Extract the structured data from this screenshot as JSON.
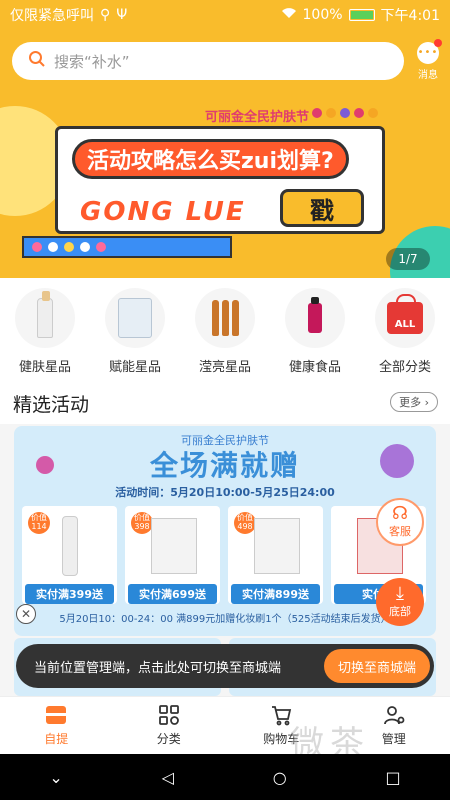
{
  "status": {
    "carrier": "仅限紧急呼叫",
    "battery": "100%",
    "time": "下午4:01"
  },
  "header": {
    "search_placeholder": "搜索“补水”",
    "message_label": "消息"
  },
  "banner": {
    "brand": "可丽金全民护肤节",
    "headline": "活动攻略怎么买zui划算?",
    "subline": "GONG LUE",
    "stamp": "戳",
    "counter": "1/7"
  },
  "categories": [
    {
      "label": "健肤星品",
      "icon": "serum-bottle-icon"
    },
    {
      "label": "赋能星品",
      "icon": "box-set-icon"
    },
    {
      "label": "滢亮星品",
      "icon": "ampoule-icon"
    },
    {
      "label": "健康食品",
      "icon": "drink-bottle-icon"
    },
    {
      "label": "全部分类",
      "icon": "all-bag-icon"
    }
  ],
  "section": {
    "title": "精选活动",
    "more": "更多"
  },
  "promo": {
    "brand": "可丽金全民护肤节",
    "title": "全场满就赠",
    "time": "活动时间：5月20日10:00-5月25日24:00",
    "products": [
      {
        "tag_top": "价值",
        "tag_value": "114",
        "button": "实付满399送"
      },
      {
        "tag_top": "价值",
        "tag_value": "398",
        "button": "实付满699送"
      },
      {
        "tag_top": "价值",
        "tag_value": "498",
        "button": "实付满899送"
      },
      {
        "tag_top": "",
        "tag_value": "",
        "button": "实付满"
      }
    ],
    "footer": "5月20日10：00-24：00 满899元加赠化妆刷1个（525活动结束后发货）"
  },
  "floating": {
    "service": "客服",
    "bottom": "底部"
  },
  "toast": {
    "text": "当前位置管理端，点击此处可切换至商城端",
    "button": "切换至商城端"
  },
  "tabbar": [
    {
      "label": "自提",
      "icon": "pickup-icon",
      "active": true
    },
    {
      "label": "分类",
      "icon": "category-icon",
      "active": false
    },
    {
      "label": "购物车",
      "icon": "cart-icon",
      "active": false
    },
    {
      "label": "管理",
      "icon": "manage-icon",
      "active": false
    }
  ],
  "watermark": "微茶",
  "colors": {
    "brand": "#f9bc2c",
    "accent": "#ff7a2e",
    "promo_blue": "#2a88d8"
  }
}
